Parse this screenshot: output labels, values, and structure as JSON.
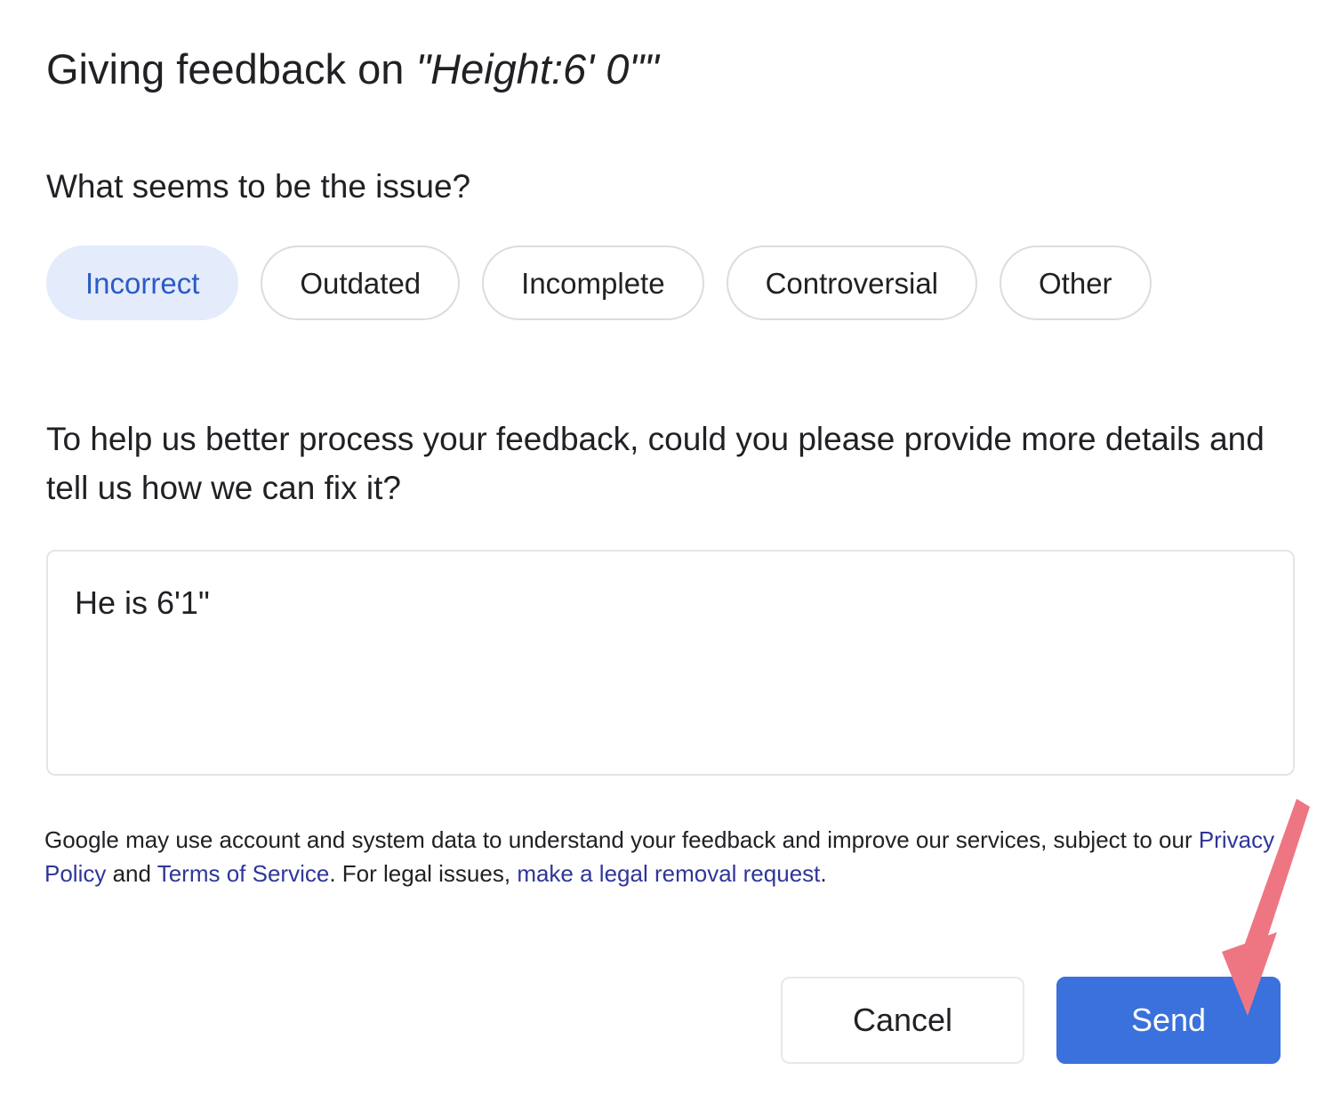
{
  "dialog": {
    "title_prefix": "Giving feedback on ",
    "title_subject": "\"Height:6' 0\"\"",
    "question": "What seems to be the issue?",
    "issue_chips": [
      {
        "label": "Incorrect",
        "selected": true
      },
      {
        "label": "Outdated",
        "selected": false
      },
      {
        "label": "Incomplete",
        "selected": false
      },
      {
        "label": "Controversial",
        "selected": false
      },
      {
        "label": "Other",
        "selected": false
      }
    ],
    "prompt": "To help us better process your feedback, could you please provide more details and tell us how we can fix it?",
    "feedback": {
      "value": "He is 6'1\"",
      "placeholder": ""
    },
    "legal": {
      "part1": "Google may use account and system data to understand your feedback and improve our services, subject to our ",
      "link_privacy": "Privacy Policy",
      "part2": " and ",
      "link_terms": "Terms of Service",
      "part3": ". For legal issues, ",
      "link_removal": "make a legal removal request",
      "part4": "."
    },
    "buttons": {
      "cancel": "Cancel",
      "send": "Send"
    }
  },
  "annotation": {
    "arrow": "down-left-arrow pointing at Send button",
    "color": "#ee7683"
  },
  "colors": {
    "accent_blue": "#3a71dc",
    "chip_selected_bg": "#e4ebfb",
    "chip_selected_text": "#2b5cc5",
    "link": "#2f3698",
    "arrow_pink": "#ee7683"
  }
}
